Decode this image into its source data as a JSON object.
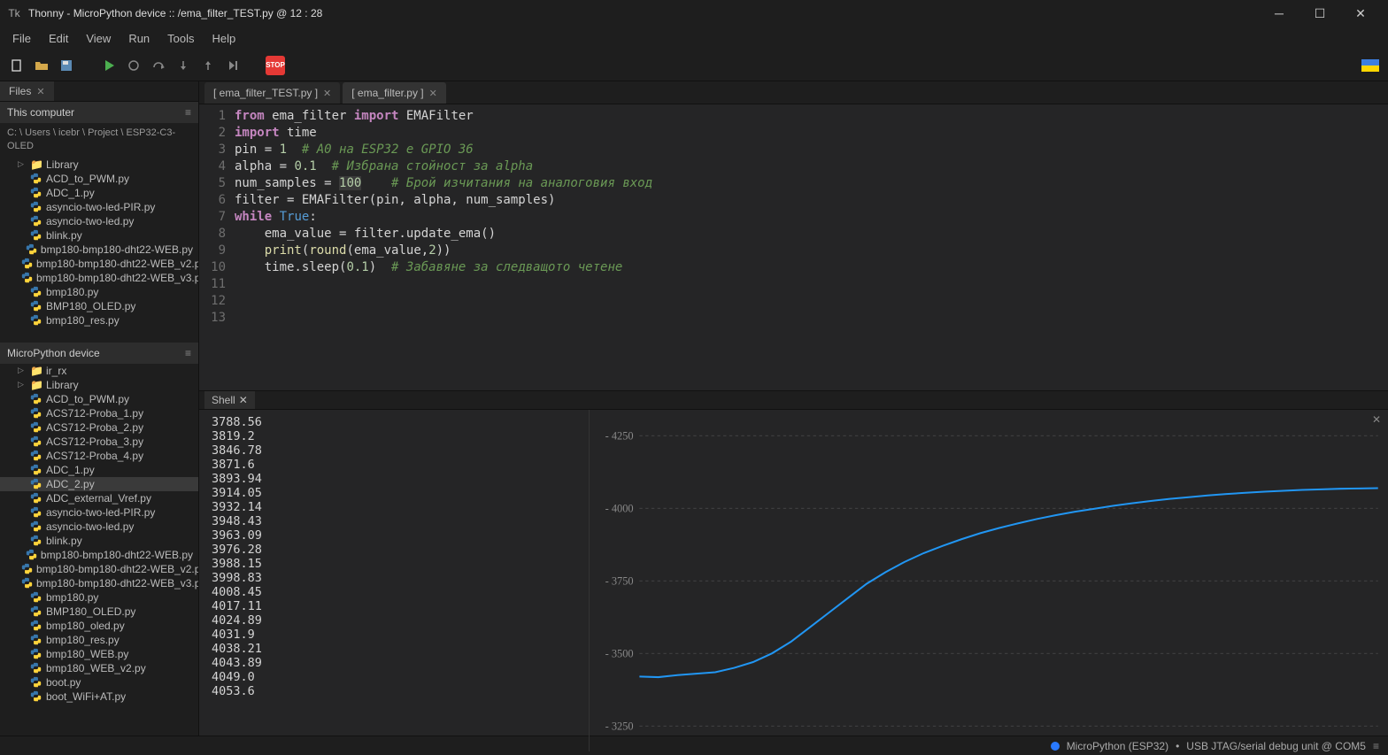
{
  "window": {
    "title": "Thonny  -  MicroPython device :: /ema_filter_TEST.py  @  12 : 28"
  },
  "menu": [
    "File",
    "Edit",
    "View",
    "Run",
    "Tools",
    "Help"
  ],
  "sidebar": {
    "files_tab": "Files",
    "panel1_header": "This computer",
    "panel1_path": "C: \\ Users \\ icebr \\ Project \\ ESP32-C3-OLED",
    "panel1_items": [
      {
        "type": "folder",
        "label": "Library"
      },
      {
        "type": "py",
        "label": "ACD_to_PWM.py"
      },
      {
        "type": "py",
        "label": "ADC_1.py"
      },
      {
        "type": "py",
        "label": "asyncio-two-led-PIR.py"
      },
      {
        "type": "py",
        "label": "asyncio-two-led.py"
      },
      {
        "type": "py",
        "label": "blink.py"
      },
      {
        "type": "py",
        "label": "bmp180-bmp180-dht22-WEB.py"
      },
      {
        "type": "py",
        "label": "bmp180-bmp180-dht22-WEB_v2.p"
      },
      {
        "type": "py",
        "label": "bmp180-bmp180-dht22-WEB_v3.p"
      },
      {
        "type": "py",
        "label": "bmp180.py"
      },
      {
        "type": "py",
        "label": "BMP180_OLED.py"
      },
      {
        "type": "py",
        "label": "bmp180_res.py"
      }
    ],
    "panel2_header": "MicroPython device",
    "panel2_items": [
      {
        "type": "folder",
        "label": "ir_rx"
      },
      {
        "type": "folder",
        "label": "Library"
      },
      {
        "type": "py",
        "label": "ACD_to_PWM.py"
      },
      {
        "type": "py",
        "label": "ACS712-Proba_1.py"
      },
      {
        "type": "py",
        "label": "ACS712-Proba_2.py"
      },
      {
        "type": "py",
        "label": "ACS712-Proba_3.py"
      },
      {
        "type": "py",
        "label": "ACS712-Proba_4.py"
      },
      {
        "type": "py",
        "label": "ADC_1.py"
      },
      {
        "type": "py",
        "label": "ADC_2.py",
        "selected": true
      },
      {
        "type": "py",
        "label": "ADC_external_Vref.py"
      },
      {
        "type": "py",
        "label": "asyncio-two-led-PIR.py"
      },
      {
        "type": "py",
        "label": "asyncio-two-led.py"
      },
      {
        "type": "py",
        "label": "blink.py"
      },
      {
        "type": "py",
        "label": "bmp180-bmp180-dht22-WEB.py"
      },
      {
        "type": "py",
        "label": "bmp180-bmp180-dht22-WEB_v2.p"
      },
      {
        "type": "py",
        "label": "bmp180-bmp180-dht22-WEB_v3.p"
      },
      {
        "type": "py",
        "label": "bmp180.py"
      },
      {
        "type": "py",
        "label": "BMP180_OLED.py"
      },
      {
        "type": "py",
        "label": "bmp180_oled.py"
      },
      {
        "type": "py",
        "label": "bmp180_res.py"
      },
      {
        "type": "py",
        "label": "bmp180_WEB.py"
      },
      {
        "type": "py",
        "label": "bmp180_WEB_v2.py"
      },
      {
        "type": "py",
        "label": "boot.py"
      },
      {
        "type": "py",
        "label": "boot_WiFi+AT.py"
      }
    ]
  },
  "editor": {
    "tabs": [
      {
        "label": "[ ema_filter_TEST.py ]"
      },
      {
        "label": "[ ema_filter.py ]",
        "active": true
      }
    ]
  },
  "shell": {
    "tab": "Shell",
    "output": [
      "3788.56",
      "3819.2",
      "3846.78",
      "3871.6",
      "3893.94",
      "3914.05",
      "3932.14",
      "3948.43",
      "3963.09",
      "3976.28",
      "3988.15",
      "3998.83",
      "4008.45",
      "4017.11",
      "4024.89",
      "4031.9",
      "4038.21",
      "4043.89",
      "4049.0",
      "4053.6"
    ]
  },
  "chart_data": {
    "type": "line",
    "title": "",
    "yticks": [
      4250,
      4000,
      3750,
      3500,
      3250
    ],
    "ylim": [
      3200,
      4300
    ],
    "x": [
      0,
      1,
      2,
      3,
      4,
      5,
      6,
      7,
      8,
      9,
      10,
      11,
      12,
      13,
      14,
      15,
      16,
      17,
      18,
      19,
      20,
      21,
      22,
      23,
      24,
      25,
      26,
      27,
      28,
      29,
      30,
      31,
      32,
      33,
      34,
      35,
      36,
      37,
      38,
      39
    ],
    "values": [
      3420,
      3418,
      3425,
      3430,
      3435,
      3450,
      3470,
      3500,
      3540,
      3590,
      3640,
      3690,
      3740,
      3780,
      3815,
      3845,
      3870,
      3893,
      3914,
      3932,
      3948,
      3963,
      3976,
      3988,
      3998,
      4008,
      4017,
      4025,
      4032,
      4038,
      4044,
      4049,
      4053,
      4057,
      4060,
      4063,
      4065,
      4067,
      4068,
      4069
    ]
  },
  "statusbar": {
    "device": "MicroPython (ESP32)",
    "sep": "•",
    "port": "USB JTAG/serial debug unit @ COM5"
  }
}
